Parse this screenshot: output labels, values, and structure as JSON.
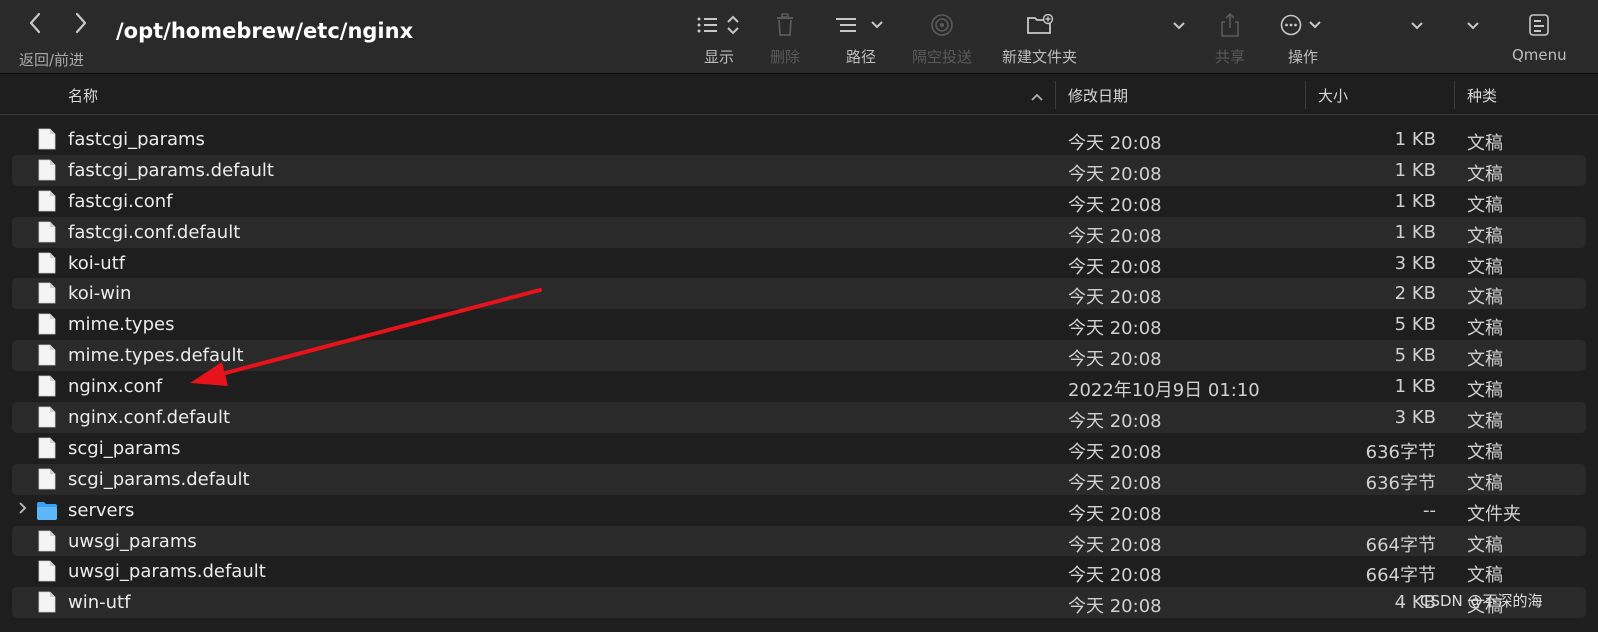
{
  "toolbar": {
    "path": "/opt/homebrew/etc/nginx",
    "nav_label": "返回/前进",
    "view_label": "显示",
    "delete_label": "删除",
    "group_label": "路径",
    "airdrop_label": "隔空投送",
    "new_folder_label": "新建文件夹",
    "share_label": "共享",
    "action_label": "操作",
    "qmenu_label": "Qmenu"
  },
  "columns": {
    "name": "名称",
    "date": "修改日期",
    "size": "大小",
    "kind": "种类"
  },
  "files": [
    {
      "name": "fastcgi_params",
      "date": "今天 20:08",
      "size": "1 KB",
      "kind": "文稿",
      "type": "file"
    },
    {
      "name": "fastcgi_params.default",
      "date": "今天 20:08",
      "size": "1 KB",
      "kind": "文稿",
      "type": "file"
    },
    {
      "name": "fastcgi.conf",
      "date": "今天 20:08",
      "size": "1 KB",
      "kind": "文稿",
      "type": "file"
    },
    {
      "name": "fastcgi.conf.default",
      "date": "今天 20:08",
      "size": "1 KB",
      "kind": "文稿",
      "type": "file"
    },
    {
      "name": "koi-utf",
      "date": "今天 20:08",
      "size": "3 KB",
      "kind": "文稿",
      "type": "file"
    },
    {
      "name": "koi-win",
      "date": "今天 20:08",
      "size": "2 KB",
      "kind": "文稿",
      "type": "file"
    },
    {
      "name": "mime.types",
      "date": "今天 20:08",
      "size": "5 KB",
      "kind": "文稿",
      "type": "file"
    },
    {
      "name": "mime.types.default",
      "date": "今天 20:08",
      "size": "5 KB",
      "kind": "文稿",
      "type": "file"
    },
    {
      "name": "nginx.conf",
      "date": "2022年10月9日 01:10",
      "size": "1 KB",
      "kind": "文稿",
      "type": "file"
    },
    {
      "name": "nginx.conf.default",
      "date": "今天 20:08",
      "size": "3 KB",
      "kind": "文稿",
      "type": "file"
    },
    {
      "name": "scgi_params",
      "date": "今天 20:08",
      "size": "636字节",
      "kind": "文稿",
      "type": "file"
    },
    {
      "name": "scgi_params.default",
      "date": "今天 20:08",
      "size": "636字节",
      "kind": "文稿",
      "type": "file"
    },
    {
      "name": "servers",
      "date": "今天 20:08",
      "size": "--",
      "kind": "文件夹",
      "type": "folder"
    },
    {
      "name": "uwsgi_params",
      "date": "今天 20:08",
      "size": "664字节",
      "kind": "文稿",
      "type": "file"
    },
    {
      "name": "uwsgi_params.default",
      "date": "今天 20:08",
      "size": "664字节",
      "kind": "文稿",
      "type": "file"
    },
    {
      "name": "win-utf",
      "date": "今天 20:08",
      "size": "4 KB",
      "kind": "文稿",
      "type": "file"
    }
  ],
  "watermark": "CSDN @不深的海",
  "colors": {
    "annotation_arrow": "#e8121b",
    "folder_blue": "#3aa0f0",
    "row_alt": "#2a2a2a"
  }
}
